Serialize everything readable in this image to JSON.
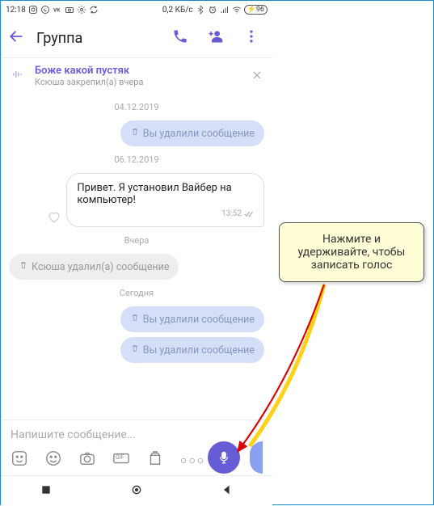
{
  "statusbar": {
    "time": "12:18",
    "net": "0,2 КБ/с",
    "battery": "96"
  },
  "header": {
    "title": "Группа"
  },
  "pinned": {
    "title": "Боже какой пустяк",
    "subtitle": "Ксюша закрепил(а) вчера"
  },
  "chat": {
    "dates": [
      "04.12.2019",
      "06.12.2019",
      "Вчера",
      "Сегодня"
    ],
    "deleted_out": "Вы удалили сообщение",
    "deleted_in": "Ксюша удалил(а) сообщение",
    "msg1": {
      "text": "Привет. Я установил Вайбер на компьютер!",
      "time": "13:52"
    }
  },
  "composer": {
    "placeholder": "Напишите сообщение...",
    "more": "○○○",
    "gif": "GIF"
  },
  "tooltip": "Нажмите и удерживайте, чтобы записать голос"
}
